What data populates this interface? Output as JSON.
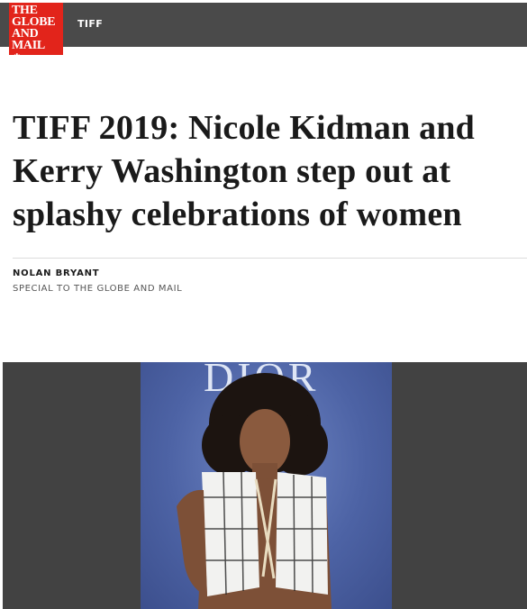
{
  "header": {
    "logo": {
      "line1": "THE",
      "line2": "GLOBE",
      "line3": "AND",
      "line4": "MAIL",
      "leaf_icon": "maple-leaf-icon"
    },
    "section": "TIFF"
  },
  "article": {
    "headline": "TIFF 2019: Nicole Kidman and Kerry Washington step out at splashy celebrations of women",
    "author": "NOLAN BRYANT",
    "author_role": "SPECIAL TO THE GLOBE AND MAIL"
  },
  "photo": {
    "backdrop_text": "DIOR"
  },
  "colors": {
    "brand_red": "#e2241b",
    "nav_bar": "#4a4a4a",
    "photo_backdrop": "#5068a8"
  }
}
